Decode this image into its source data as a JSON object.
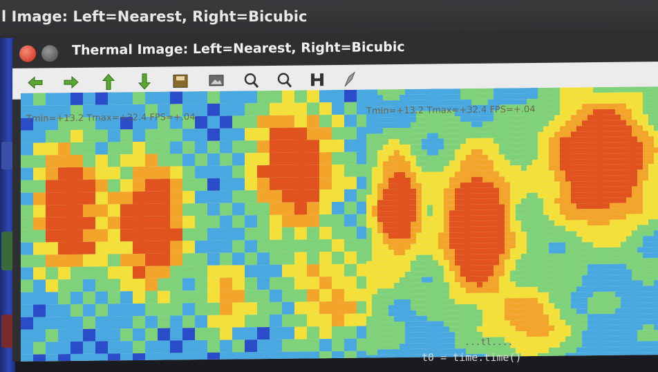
{
  "background_window": {
    "title": "l Image: Left=Nearest, Right=Bicubic"
  },
  "window": {
    "title": "Thermal Image: Left=Nearest, Right=Bicubic"
  },
  "toolbar": {
    "tools": [
      {
        "icon": "home-back-arrow-icon"
      },
      {
        "icon": "forward-arrow-icon"
      },
      {
        "icon": "up-arrow-icon"
      },
      {
        "icon": "down-arrow-icon"
      },
      {
        "icon": "save-icon"
      },
      {
        "icon": "image-icon"
      },
      {
        "icon": "zoom-in-icon"
      },
      {
        "icon": "zoom-out-icon"
      },
      {
        "icon": "fit-icon"
      },
      {
        "icon": "pointer-icon"
      }
    ]
  },
  "overlay": {
    "left": "Tmin=+13.2 Tmax=+32.4 FPS=+.04",
    "right": "Tmin=+13.2 Tmax=+32.4 FPS=+.04"
  },
  "code": {
    "line": "t0 = time.time()",
    "faint": "...tl...."
  },
  "colors": {
    "hot": "#e0521e",
    "warm": "#f2a52a",
    "mid": "#f3e03a",
    "cool": "#7fd27a",
    "cold": "#4aa8e0",
    "coldest": "#2b4cc8"
  }
}
